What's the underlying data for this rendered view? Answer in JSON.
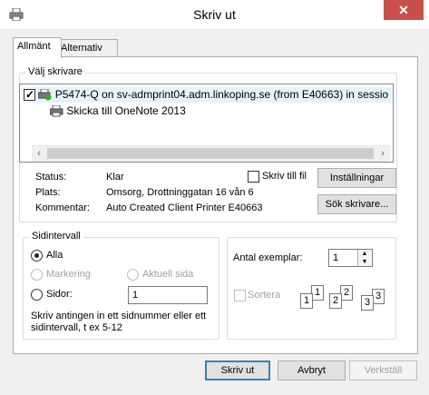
{
  "window": {
    "title": "Skriv ut",
    "close_glyph": "✕"
  },
  "tabs": [
    {
      "label": "Allmänt"
    },
    {
      "label": "Alternativ"
    }
  ],
  "select_printer": {
    "group_label": "Välj skrivare",
    "printers": [
      {
        "name": "P5474-Q on sv-admprint04.adm.linkoping.se (from E40663) in sessio",
        "selected": true,
        "icon": "network-printer-icon"
      },
      {
        "name": "Skicka till OneNote 2013",
        "selected": false,
        "icon": "printer-icon"
      }
    ],
    "scroll_left": "‹",
    "scroll_right": "›"
  },
  "status": {
    "status_label": "Status:",
    "status_value": "Klar",
    "location_label": "Plats:",
    "location_value": "Omsorg, Drottninggatan 16 vån 6",
    "comment_label": "Kommentar:",
    "comment_value": "Auto Created Client Printer E40663",
    "print_to_file_label": "Skriv till fil",
    "settings_button": "Inställningar",
    "find_printer_button": "Sök skrivare..."
  },
  "page_range": {
    "group_label": "Sidintervall",
    "all_label": "Alla",
    "selection_label": "Markering",
    "current_page_label": "Aktuell sida",
    "pages_label": "Sidor:",
    "pages_value": "1",
    "help_text_line1": "Skriv antingen in ett sidnummer eller ett",
    "help_text_line2": "sidintervall, t ex 5-12"
  },
  "copies": {
    "label": "Antal exemplar:",
    "value": "1",
    "up_glyph": "▲",
    "down_glyph": "▼",
    "collate_label": "Sortera",
    "collate_pages": [
      "1",
      "1",
      "2",
      "2",
      "3",
      "3"
    ]
  },
  "footer": {
    "print_button": "Skriv ut",
    "cancel_button": "Avbryt",
    "apply_button": "Verkställ"
  }
}
